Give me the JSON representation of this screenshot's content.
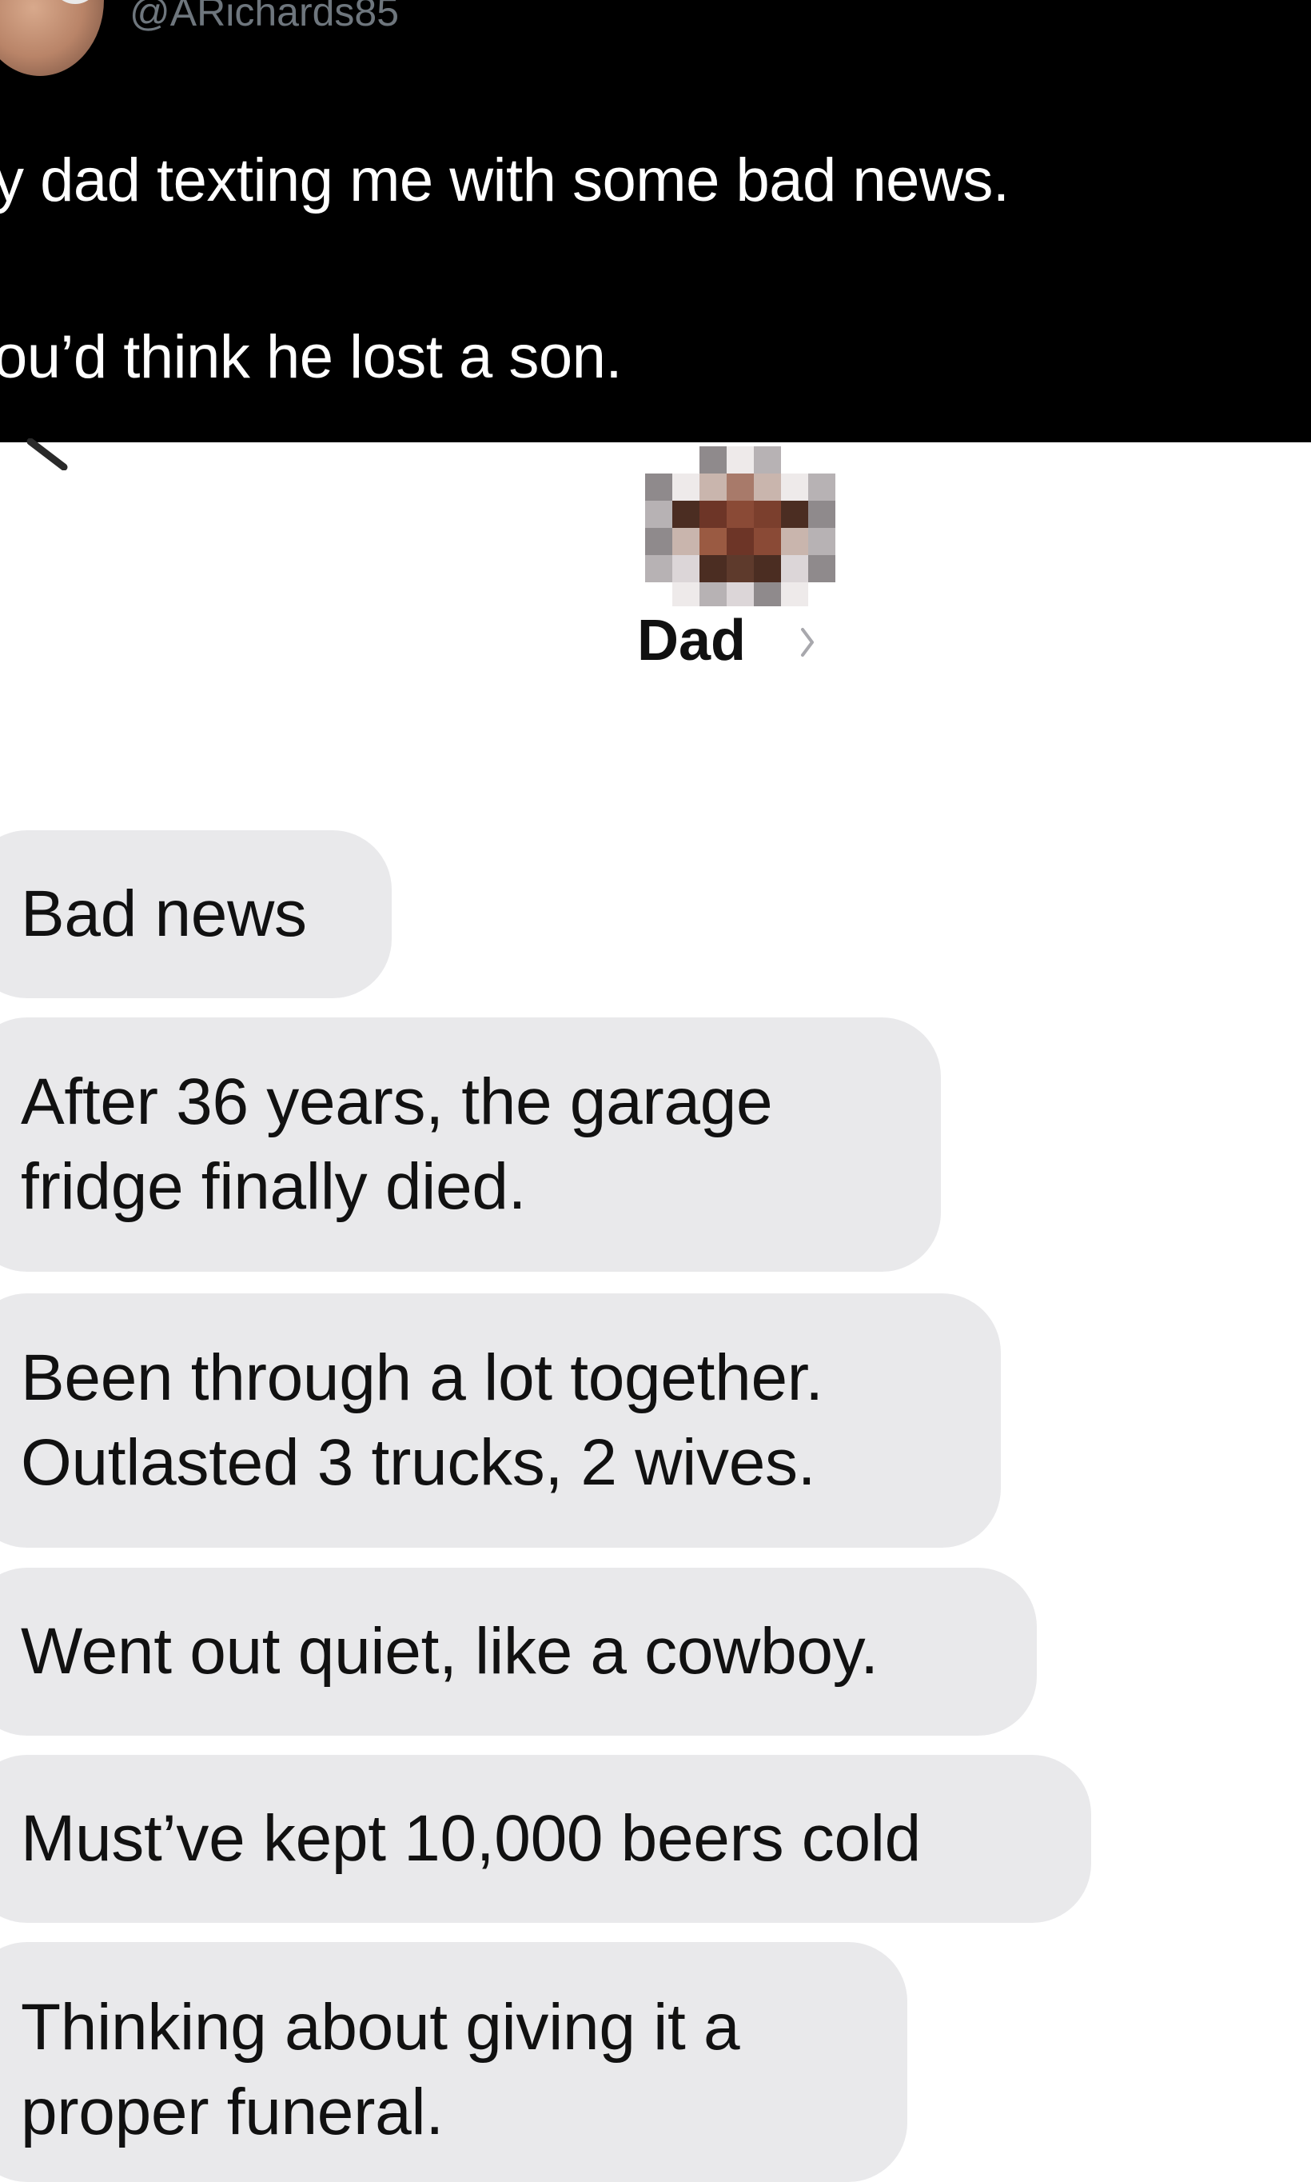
{
  "tweet": {
    "handle": "@ARichards85",
    "lines": [
      "y dad texting me with some bad news.",
      "ou’d think he lost a son."
    ]
  },
  "conversation": {
    "contact_name": "Dad",
    "messages": [
      "Bad news",
      "After 36 years, the garage\nfridge finally died.",
      "Been through a lot together.\nOutlasted 3 trucks, 2 wives.",
      "Went out quiet, like a cowboy.",
      "Must’ve kept 10,000 beers cold",
      "Thinking about giving it a\nproper funeral."
    ]
  },
  "colors": {
    "tweet_background": "#000000",
    "tweet_text": "#ffffff",
    "handle_text": "#6e767d",
    "received_bubble": "#e9e9eb"
  }
}
